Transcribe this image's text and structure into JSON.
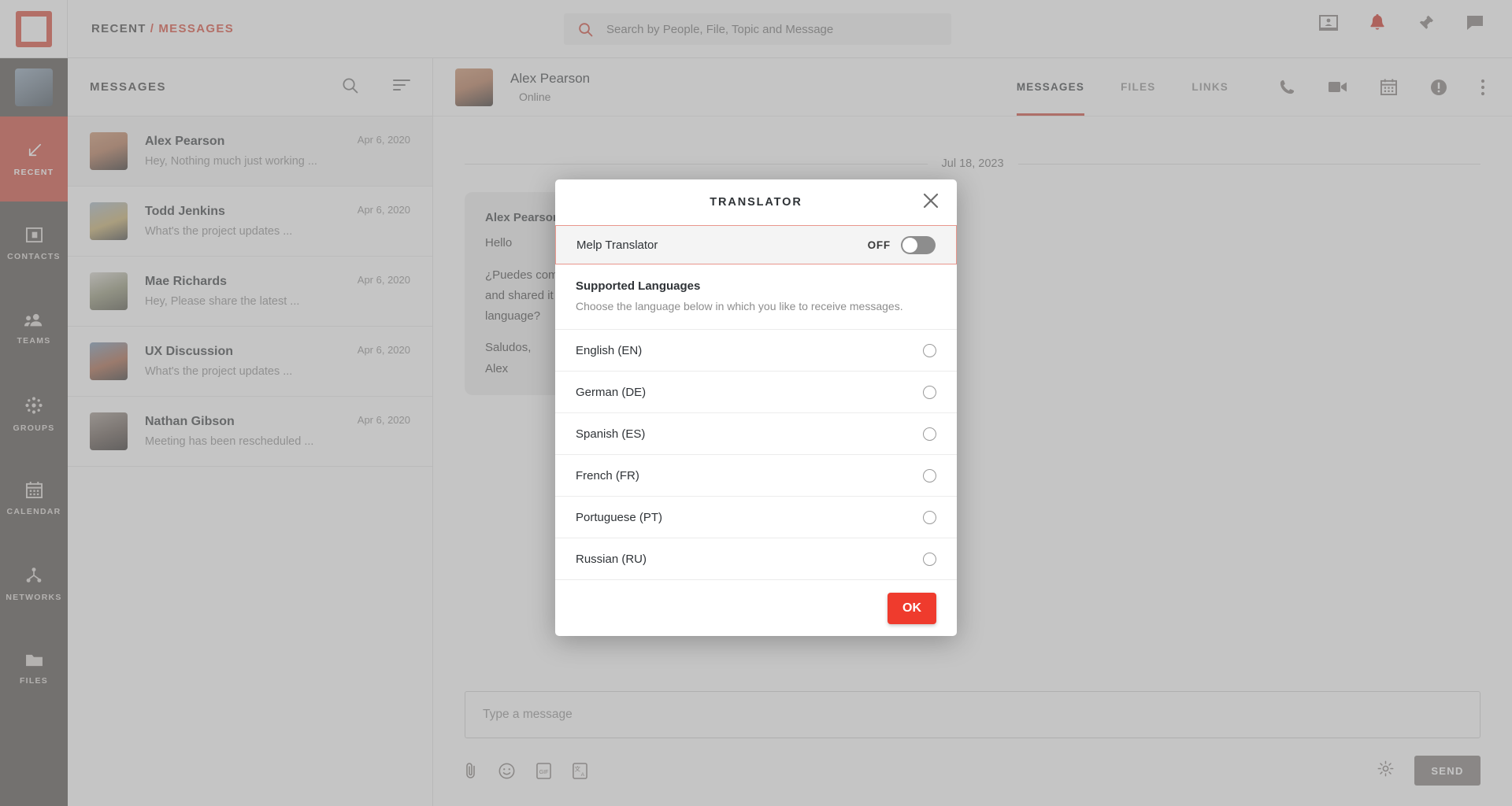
{
  "header": {
    "breadcrumb": {
      "first": "RECENT",
      "separator": "/",
      "second": "MESSAGES"
    },
    "search": {
      "placeholder": "Search by People, File, Topic and Message",
      "value": "",
      "icon": "search-icon"
    },
    "icons": [
      "webinar-icon",
      "bell-icon",
      "pin-icon",
      "chat-bubble-icon"
    ]
  },
  "sidebar": {
    "items": [
      {
        "label": "RECENT",
        "icon": "arrow-down-left-icon",
        "active": true
      },
      {
        "label": "CONTACTS",
        "icon": "contact-card-icon",
        "active": false
      },
      {
        "label": "TEAMS",
        "icon": "people-icon",
        "active": false
      },
      {
        "label": "GROUPS",
        "icon": "group-dots-icon",
        "active": false
      },
      {
        "label": "CALENDAR",
        "icon": "calendar-icon",
        "active": false
      },
      {
        "label": "NETWORKS",
        "icon": "network-icon",
        "active": false
      },
      {
        "label": "FILES",
        "icon": "folder-icon",
        "active": false
      }
    ]
  },
  "message_list": {
    "title": "MESSAGES",
    "search_icon": "search-icon",
    "filter_icon": "sort-filter-icon",
    "items": [
      {
        "name": "Alex Pearson",
        "preview": "Hey, Nothing much just working ...",
        "date": "Apr 6, 2020",
        "selected": true
      },
      {
        "name": "Todd Jenkins",
        "preview": "What's the project updates ...",
        "date": "Apr 6, 2020",
        "selected": false
      },
      {
        "name": "Mae Richards",
        "preview": "Hey, Please share the latest ...",
        "date": "Apr 6, 2020",
        "selected": false
      },
      {
        "name": "UX Discussion",
        "preview": "What's the project updates ...",
        "date": "Apr 6, 2020",
        "selected": false
      },
      {
        "name": "Nathan Gibson",
        "preview": "Meeting has been rescheduled ...",
        "date": "Apr 6, 2020",
        "selected": false
      }
    ]
  },
  "chat": {
    "contact_name": "Alex Pearson",
    "status": "Online",
    "tabs": [
      {
        "label": "MESSAGES",
        "active": true
      },
      {
        "label": "FILES",
        "active": false
      },
      {
        "label": "LINKS",
        "active": false
      }
    ],
    "action_icons": [
      "phone-icon",
      "video-camera-icon",
      "calendar-icon",
      "info-icon",
      "more-vertical-icon"
    ],
    "date_separator": "Jul 18, 2023",
    "bubble": {
      "sender": "Alex Pearson",
      "line1": "Hello",
      "line2": "¿Puedes compartir el informe de usabilidad",
      "line3": "and shared it with me in the Spanish",
      "line4": "language?",
      "line5": "Saludos,",
      "line6": "Alex"
    }
  },
  "composer": {
    "placeholder": "Type a message",
    "value": "",
    "tools": [
      "attachment-icon",
      "emoji-icon",
      "gif-icon",
      "translate-icon"
    ],
    "settings_icon": "gear-icon",
    "send_label": "SEND"
  },
  "modal": {
    "title": "TRANSLATOR",
    "close_icon": "close-icon",
    "toggle": {
      "label": "Melp Translator",
      "state_label": "OFF",
      "on": false
    },
    "section": {
      "heading": "Supported Languages",
      "description": "Choose the language below in which you like to receive messages."
    },
    "languages": [
      {
        "label": "English (EN)",
        "selected": false
      },
      {
        "label": "German (DE)",
        "selected": false
      },
      {
        "label": "Spanish (ES)",
        "selected": false
      },
      {
        "label": "French (FR)",
        "selected": false
      },
      {
        "label": "Portuguese (PT)",
        "selected": false
      },
      {
        "label": "Russian (RU)",
        "selected": false
      }
    ],
    "ok_label": "OK"
  },
  "colors": {
    "brand_red": "#cc4032",
    "accent_red": "#ef3b2d",
    "rail_dark": "#4b4541",
    "highlight": "#e8968c"
  }
}
